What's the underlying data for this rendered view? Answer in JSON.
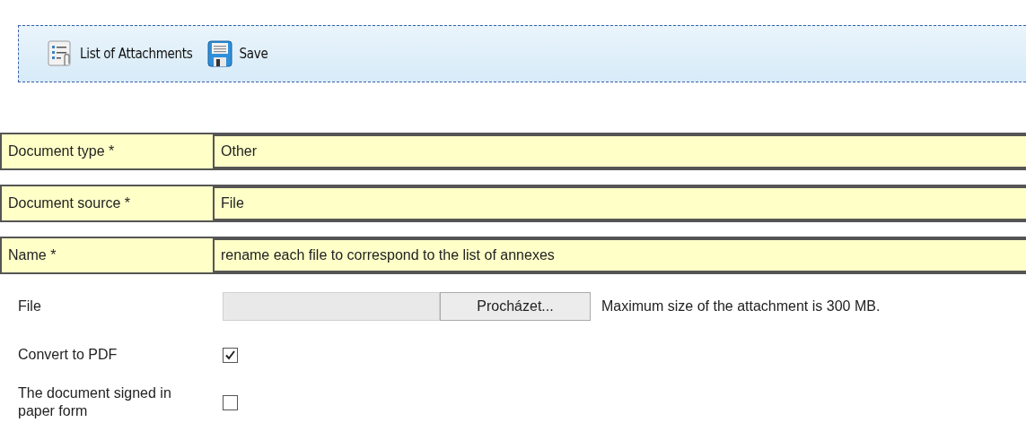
{
  "toolbar": [
    {
      "kind": "list",
      "label": "List of Attachments"
    },
    {
      "kind": "save",
      "label": "Save"
    }
  ],
  "form": [
    {
      "kind": "field",
      "label": "Document type  *",
      "value": "Other"
    },
    {
      "kind": "field",
      "label": "Document source  *",
      "value": "File"
    },
    {
      "kind": "field",
      "label": "Name  *",
      "value": "rename each file to correspond to the list of annexes"
    },
    {
      "kind": "file",
      "label": "File",
      "button": "Procházet...",
      "hint": "Maximum size of the attachment is 300 MB."
    },
    {
      "kind": "checkbox",
      "label": "Convert to PDF",
      "checked": true
    },
    {
      "kind": "checkbox",
      "label": "The document signed in paper form",
      "checked": false
    }
  ]
}
